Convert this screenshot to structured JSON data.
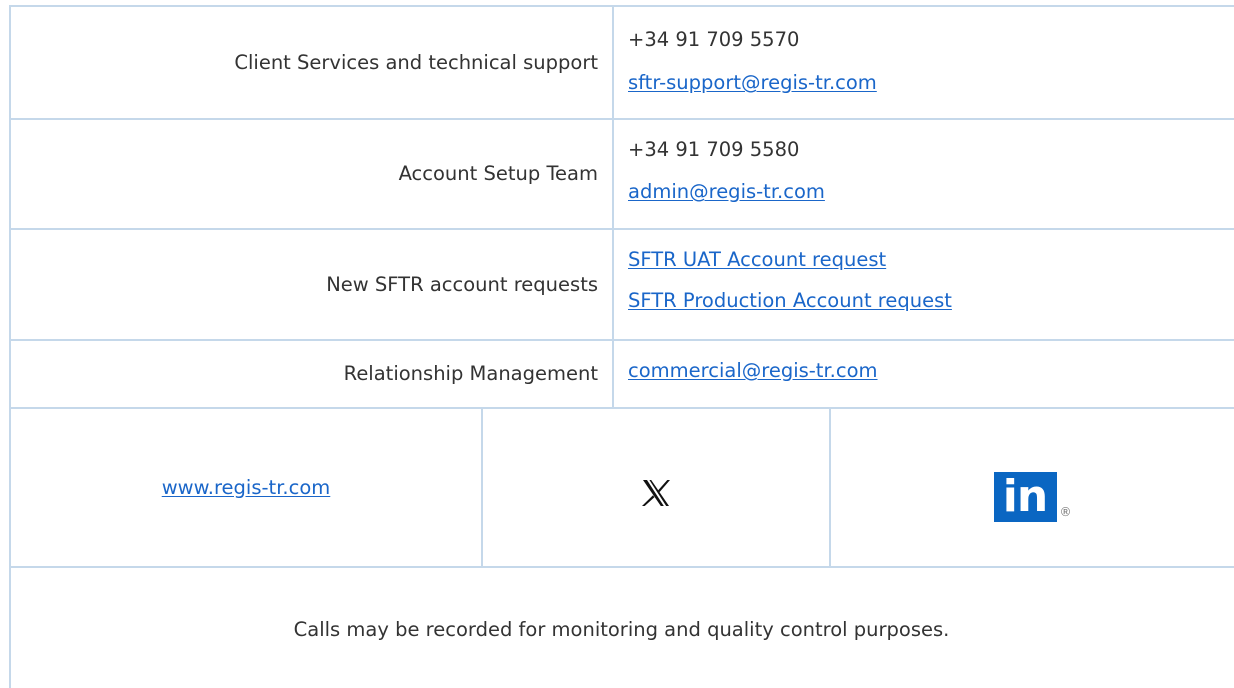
{
  "contacts": [
    {
      "label": "Client Services and technical support",
      "phone": "+34 91 709 5570",
      "email": "sftr-support@regis-tr.com"
    },
    {
      "label": "Account Setup Team",
      "phone": "+34 91 709 5580",
      "email": "admin@regis-tr.com"
    },
    {
      "label": "New SFTR account requests",
      "link_1": "SFTR UAT Account request",
      "link_2": "SFTR Production Account request"
    },
    {
      "label": "Relationship Management",
      "email": "commercial@regis-tr.com"
    }
  ],
  "footer": {
    "website": "www.regis-tr.com",
    "x_icon": "x-logo-icon",
    "linkedin_icon": "linkedin-logo-icon",
    "linkedin_text": "in",
    "linkedin_mark": "®",
    "note": "Calls may be recorded for monitoring and quality control purposes."
  },
  "colors": {
    "border": "#c5d8ea",
    "link": "#1a66c9",
    "text": "#333333",
    "linkedin": "#0a66c2"
  }
}
